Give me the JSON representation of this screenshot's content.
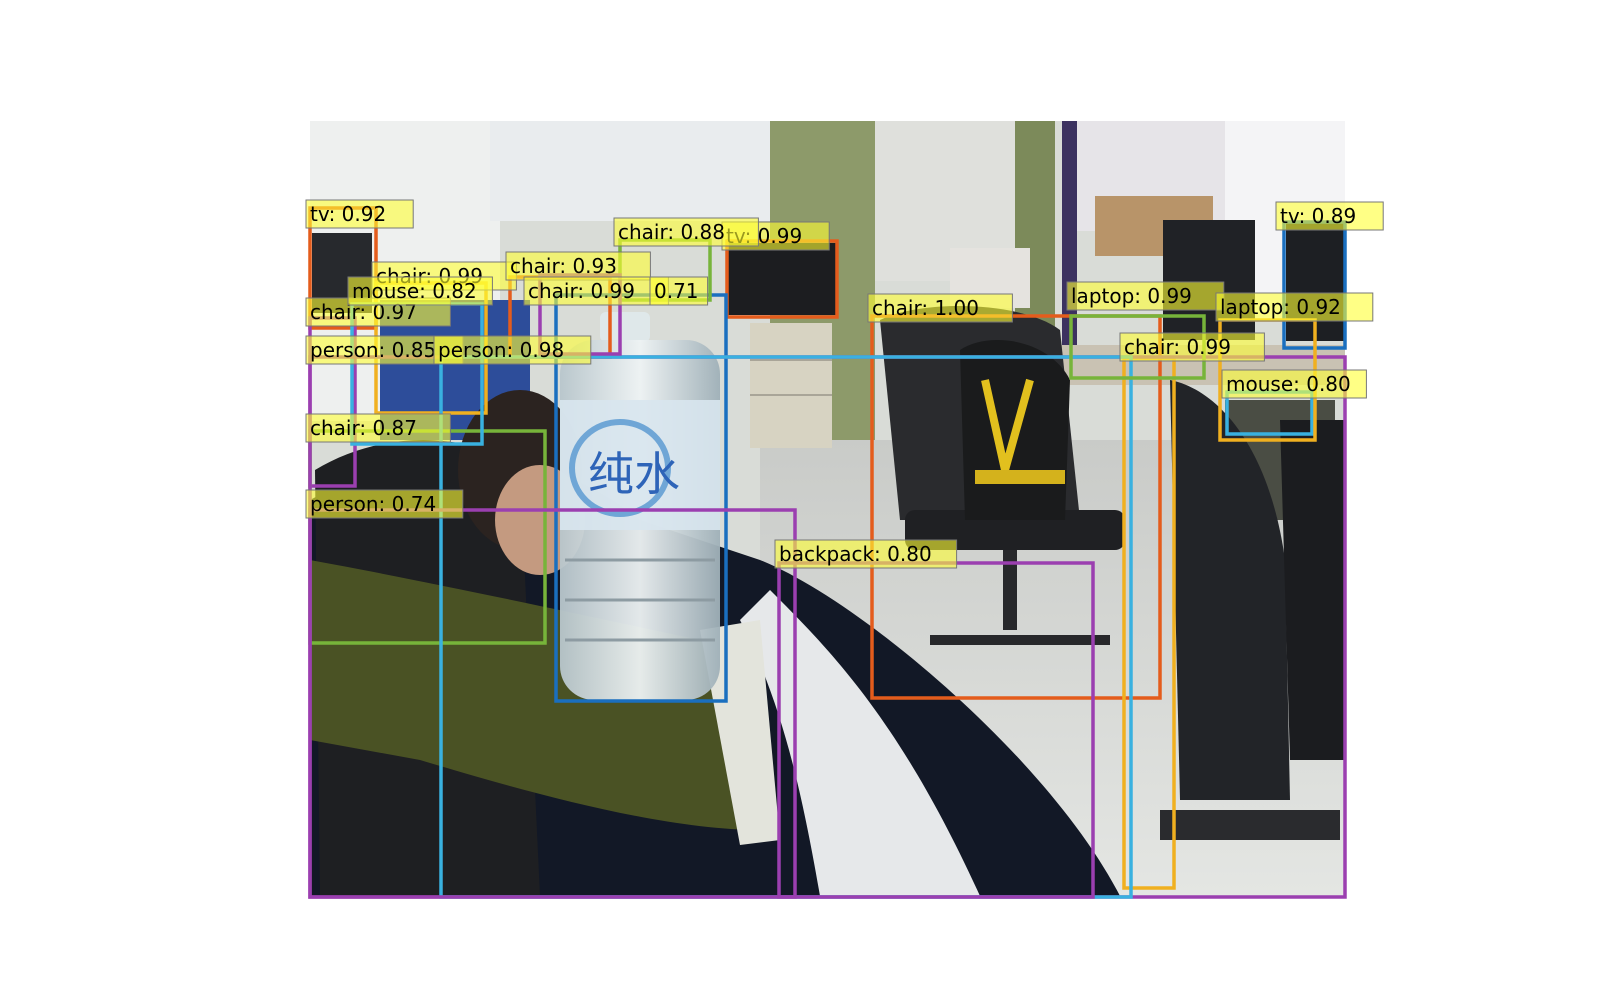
{
  "detections": [
    {
      "label": "tv",
      "score": 0.92,
      "color": "#e45c1c"
    },
    {
      "label": "tv",
      "score": 0.99,
      "color": "#e45c1c"
    },
    {
      "label": "tv",
      "score": 0.89,
      "color": "#1a6fbf"
    },
    {
      "label": "chair",
      "score": 0.99,
      "color": "#f0b020"
    },
    {
      "label": "chair",
      "score": 0.97,
      "color": "#9b3fb0"
    },
    {
      "label": "chair",
      "score": 0.87,
      "color": "#77b43a"
    },
    {
      "label": "chair",
      "score": 0.93,
      "color": "#e45c1c"
    },
    {
      "label": "chair",
      "score": 0.99,
      "color": "#1a6fbf"
    },
    {
      "label": "chair",
      "score": 0.88,
      "color": "#77b43a"
    },
    {
      "label": "chair",
      "score": 1.0,
      "color": "#e45c1c"
    },
    {
      "label": "chair",
      "score": 0.99,
      "color": "#f0b020"
    },
    {
      "label": "mouse",
      "score": 0.82,
      "color": "#39b1e0"
    },
    {
      "label": "mouse",
      "score": 0.8,
      "color": "#39b1e0"
    },
    {
      "label": "person",
      "score": 0.85,
      "color": "#9b3fb0"
    },
    {
      "label": "person",
      "score": 0.98,
      "color": "#39b1e0"
    },
    {
      "label": "person",
      "score": 0.74,
      "color": "#9b3fb0"
    },
    {
      "label": "backpack",
      "score": 0.8,
      "color": "#9b3fb0"
    },
    {
      "label": "laptop",
      "score": 0.99,
      "color": "#77b43a"
    },
    {
      "label": "laptop",
      "score": 0.92,
      "color": "#f0b020"
    },
    {
      "label": "",
      "score": 0.71,
      "color": "#9b3fb0"
    }
  ],
  "scene_text": "纯水"
}
